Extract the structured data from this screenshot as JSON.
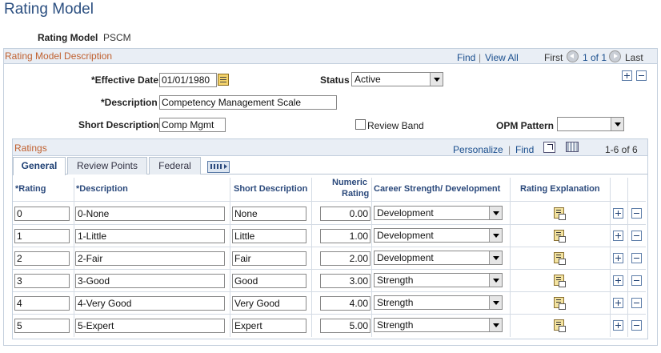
{
  "page": {
    "title": "Rating Model",
    "rating_model_label": "Rating Model",
    "rating_model_value": "PSCM"
  },
  "description_section": {
    "title": "Rating Model Description",
    "find": "Find",
    "view_all": "View All",
    "first": "First",
    "range": "1 of 1",
    "last": "Last",
    "effective_date_label": "*Effective Date",
    "effective_date_value": "01/01/1980",
    "status_label": "Status",
    "status_value": "Active",
    "description_label": "*Description",
    "description_value": "Competency Management Scale",
    "short_description_label": "Short Description",
    "short_description_value": "Comp Mgmt",
    "review_band_label": "Review Band",
    "opm_pattern_label": "OPM Pattern",
    "opm_pattern_value": ""
  },
  "ratings": {
    "title": "Ratings",
    "personalize": "Personalize",
    "find": "Find",
    "range": "1-6 of 6",
    "tabs": [
      "General",
      "Review Points",
      "Federal"
    ],
    "columns": {
      "rating": "*Rating",
      "description": "*Description",
      "short_description": "Short Description",
      "numeric_rating_1": "Numeric",
      "numeric_rating_2": "Rating",
      "career": "Career Strength/ Development",
      "explanation": "Rating Explanation"
    },
    "rows": [
      {
        "rating": "0",
        "description": "0-None",
        "short": "None",
        "numeric": "0.00",
        "career": "Development"
      },
      {
        "rating": "1",
        "description": "1-Little",
        "short": "Little",
        "numeric": "1.00",
        "career": "Development"
      },
      {
        "rating": "2",
        "description": "2-Fair",
        "short": "Fair",
        "numeric": "2.00",
        "career": "Development"
      },
      {
        "rating": "3",
        "description": "3-Good",
        "short": "Good",
        "numeric": "3.00",
        "career": "Strength"
      },
      {
        "rating": "4",
        "description": "4-Very Good",
        "short": "Very Good",
        "numeric": "4.00",
        "career": "Strength"
      },
      {
        "rating": "5",
        "description": "5-Expert",
        "short": "Expert",
        "numeric": "5.00",
        "career": "Strength"
      }
    ]
  }
}
